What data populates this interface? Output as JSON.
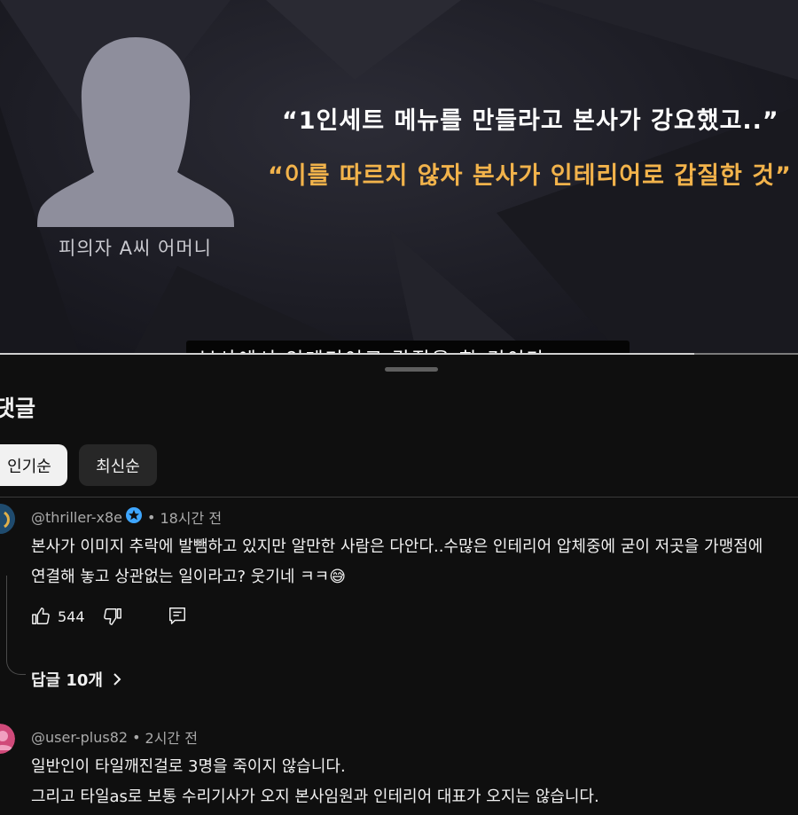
{
  "video": {
    "quote_line_1": "“1인세트 메뉴를 만들라고 본사가 강요했고..”",
    "quote_line_2": "“이를 따르지 않자 본사가 인테리어로 갑질한 것”",
    "interviewee_label": "피의자 A씨 어머니",
    "subtitle_partial": "본사에서 인테리어로 갑질을 한 것이라",
    "progress": 0.87,
    "colors": {
      "quote_highlight": "#f2b34b",
      "silhouette": "#8e8e9c"
    }
  },
  "panel": {
    "title": "댓글",
    "chips": [
      {
        "label": "인기순",
        "selected": true
      },
      {
        "label": "최신순",
        "selected": false
      }
    ]
  },
  "comments": [
    {
      "author": "@thriller-x8e",
      "verified_icon": "star-badge-icon",
      "time": "18시간 전",
      "lines": [
        "본사가 이미지 추락에 발뺌하고 있지만 알만한 사람은 다안다..수많은 인테리어 압체중에 굳이 저곳을 가맹점에",
        "연결해 놓고 상관없는 일이라고? 웃기네 ㅋㅋ😅"
      ],
      "likes": "544",
      "replies_label": "답글 10개"
    },
    {
      "author": "@user-plus82",
      "time": "2시간 전",
      "lines": [
        "일반인이 타일깨진걸로 3명을 죽이지 않습니다.",
        "그리고 타일as로 보통 수리기사가 오지 본사임원과 인테리어 대표가 오지는 않습니다."
      ]
    }
  ]
}
